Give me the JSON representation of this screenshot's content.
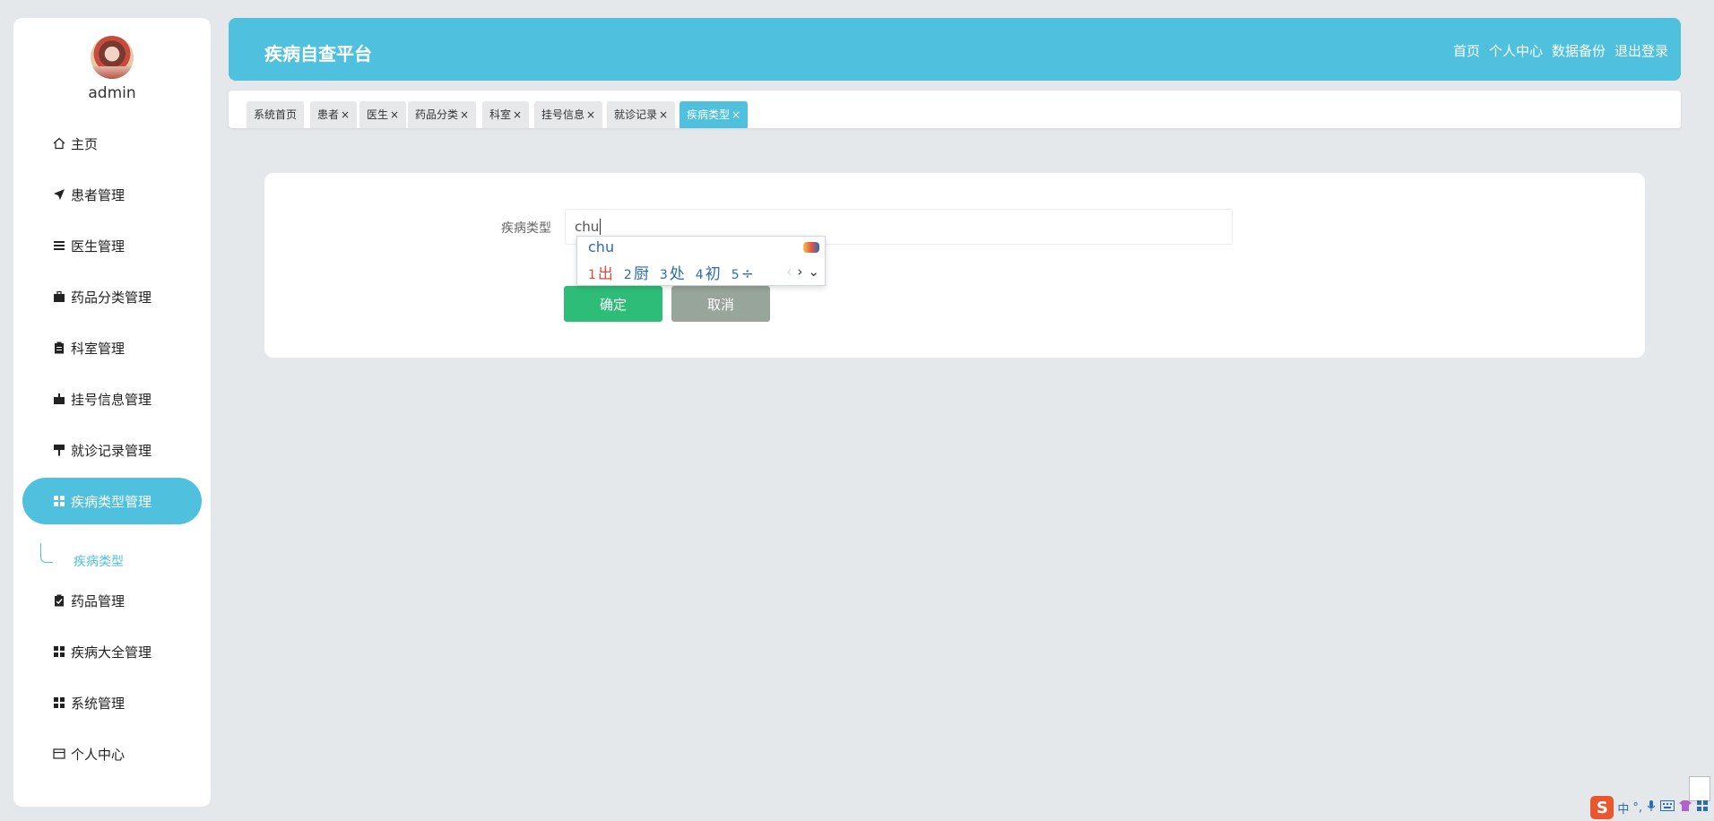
{
  "sidebar": {
    "username": "admin",
    "menu": [
      {
        "label": "主页",
        "icon": "home-icon"
      },
      {
        "label": "患者管理",
        "icon": "send-icon"
      },
      {
        "label": "医生管理",
        "icon": "list-icon"
      },
      {
        "label": "药品分类管理",
        "icon": "briefcase-icon"
      },
      {
        "label": "科室管理",
        "icon": "clipboard-icon"
      },
      {
        "label": "挂号信息管理",
        "icon": "ticket-icon"
      },
      {
        "label": "就诊记录管理",
        "icon": "signpost-icon"
      },
      {
        "label": "疾病类型管理",
        "icon": "grid-icon",
        "active": true
      },
      {
        "label": "药品管理",
        "icon": "clipboard-check-icon"
      },
      {
        "label": "疾病大全管理",
        "icon": "grid-icon"
      },
      {
        "label": "系统管理",
        "icon": "grid-icon"
      },
      {
        "label": "个人中心",
        "icon": "card-icon"
      }
    ],
    "submenu": {
      "label": "疾病类型"
    }
  },
  "header": {
    "title": "疾病自查平台",
    "links": [
      "首页",
      "个人中心",
      "数据备份",
      "退出登录"
    ]
  },
  "tabs": [
    {
      "label": "系统首页",
      "closable": false
    },
    {
      "label": "患者",
      "closable": true
    },
    {
      "label": "医生",
      "closable": true
    },
    {
      "label": "药品分类",
      "closable": true
    },
    {
      "label": "科室",
      "closable": true
    },
    {
      "label": "挂号信息",
      "closable": true
    },
    {
      "label": "就诊记录",
      "closable": true
    },
    {
      "label": "疾病类型",
      "closable": true,
      "active": true
    }
  ],
  "tab_close_glyph": "×",
  "form": {
    "field_label": "疾病类型",
    "field_value": "chu",
    "confirm_label": "确定",
    "cancel_label": "取消"
  },
  "ime": {
    "composition": "chu",
    "candidates": [
      {
        "num": "1",
        "text": "出"
      },
      {
        "num": "2",
        "text": "厨"
      },
      {
        "num": "3",
        "text": "处"
      },
      {
        "num": "4",
        "text": "初"
      },
      {
        "num": "5",
        "text": "÷"
      }
    ],
    "nav_prev": "‹",
    "nav_next": "›",
    "nav_more": "⌄"
  },
  "tray": {
    "ime_mode": "中",
    "punct": "°,"
  },
  "colors": {
    "accent": "#4fc1de",
    "confirm": "#2ebd78",
    "cancel": "#98a59a",
    "background": "#e4e8ea"
  }
}
